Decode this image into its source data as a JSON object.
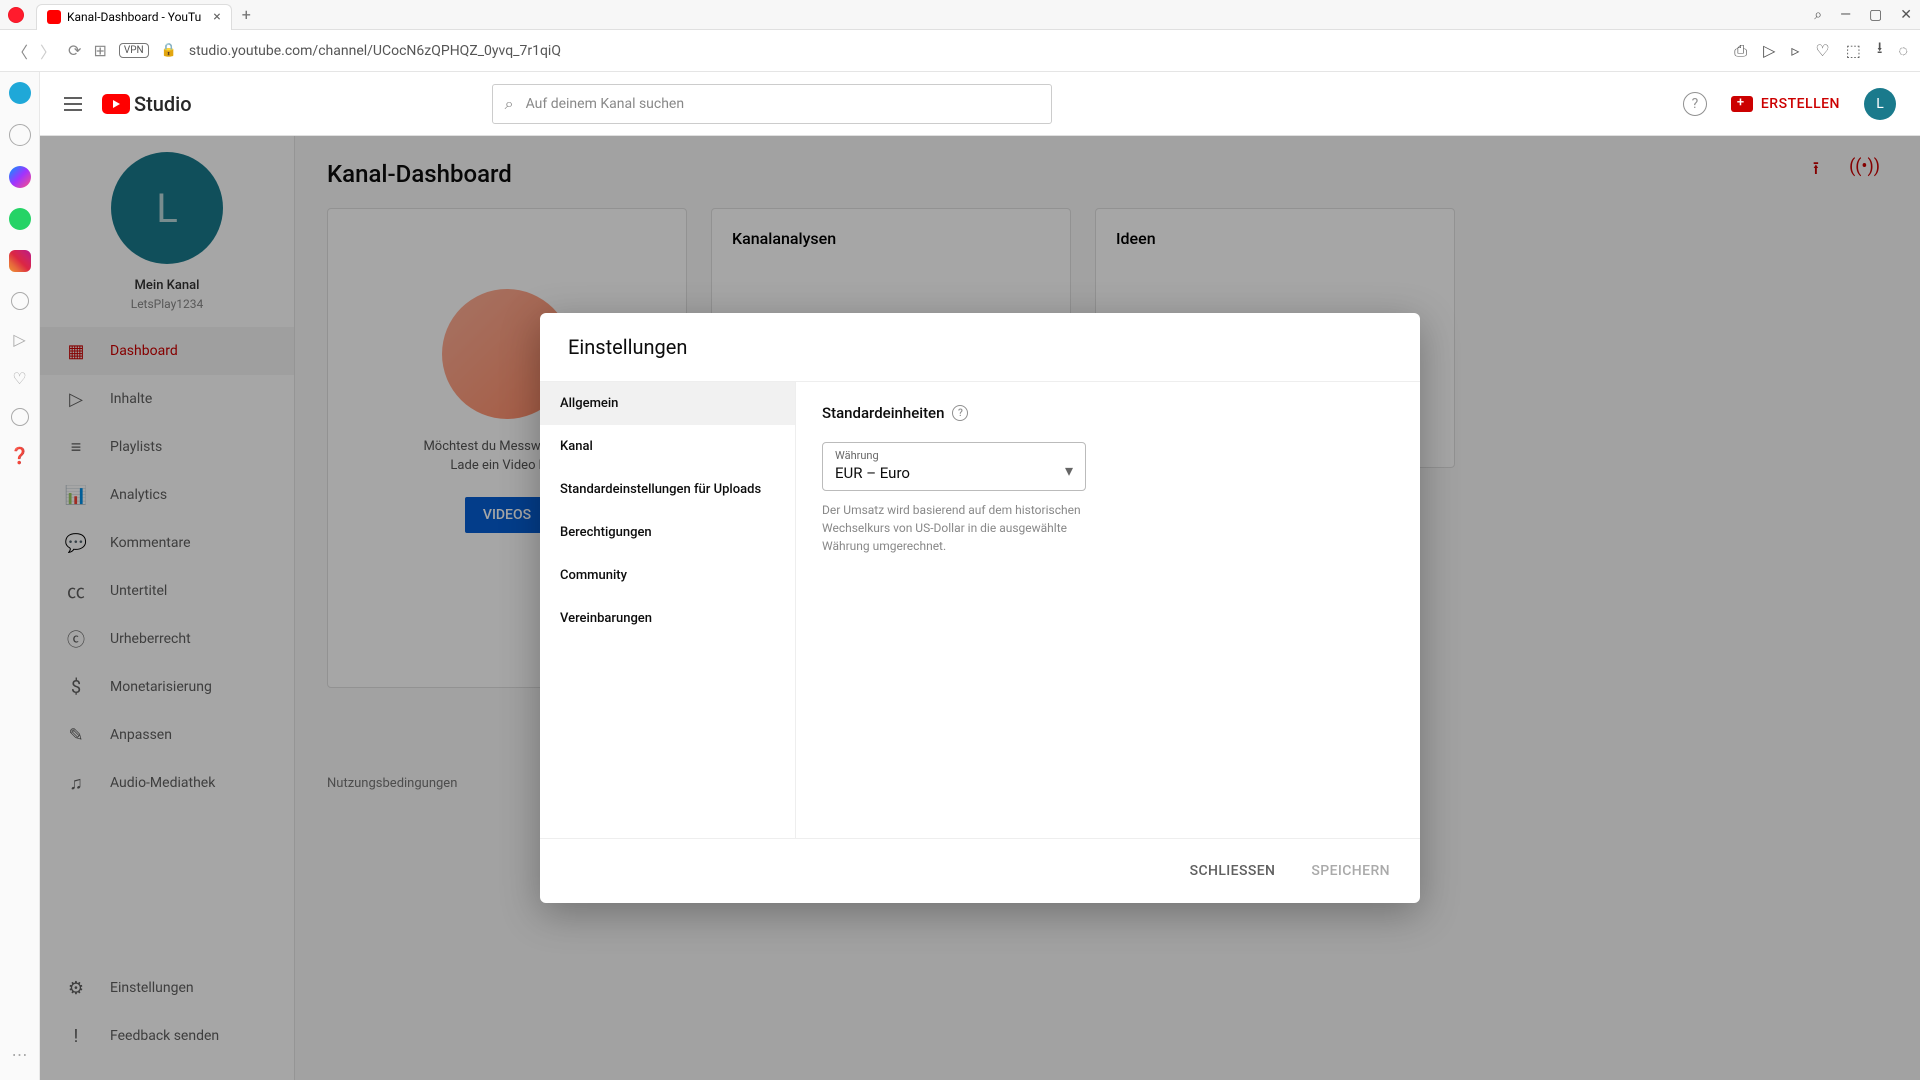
{
  "browser": {
    "tab_title": "Kanal-Dashboard - YouTu",
    "url": "studio.youtube.com/channel/UCocN6zQPHQZ_0yvq_7r1qiQ",
    "vpn": "VPN"
  },
  "header": {
    "logo_text": "Studio",
    "search_placeholder": "Auf deinem Kanal suchen",
    "create_label": "ERSTELLEN",
    "avatar_letter": "L"
  },
  "sidebar": {
    "avatar_letter": "L",
    "channel_name": "Mein Kanal",
    "channel_sub": "LetsPlay1234",
    "items": [
      {
        "label": "Dashboard",
        "icon": "▦"
      },
      {
        "label": "Inhalte",
        "icon": "▷"
      },
      {
        "label": "Playlists",
        "icon": "≡"
      },
      {
        "label": "Analytics",
        "icon": "📊"
      },
      {
        "label": "Kommentare",
        "icon": "💬"
      },
      {
        "label": "Untertitel",
        "icon": "㏄"
      },
      {
        "label": "Urheberrecht",
        "icon": "ⓒ"
      },
      {
        "label": "Monetarisierung",
        "icon": "$"
      },
      {
        "label": "Anpassen",
        "icon": "✎"
      },
      {
        "label": "Audio-Mediathek",
        "icon": "♫"
      }
    ],
    "bottom": [
      {
        "label": "Einstellungen",
        "icon": "⚙"
      },
      {
        "label": "Feedback senden",
        "icon": "!"
      }
    ]
  },
  "main": {
    "title": "Kanal-Dashboard",
    "card2_title": "Kanalanalysen",
    "card3_title": "Ideen",
    "upload_q": "Möchtest du Messwerte zu...",
    "upload_hint": "Lade ein Video ho...",
    "upload_btn": "VIDEOS",
    "terms": "Nutzungsbedingungen"
  },
  "modal": {
    "title": "Einstellungen",
    "nav": [
      "Allgemein",
      "Kanal",
      "Standardeinstellungen für Uploads",
      "Berechtigungen",
      "Community",
      "Vereinbarungen"
    ],
    "section_title": "Standardeinheiten",
    "currency_label": "Währung",
    "currency_value": "EUR – Euro",
    "currency_hint": "Der Umsatz wird basierend auf dem historischen Wechselkurs von US-Dollar in die ausgewählte Währung umgerechnet.",
    "close": "SCHLIESSEN",
    "save": "SPEICHERN"
  }
}
